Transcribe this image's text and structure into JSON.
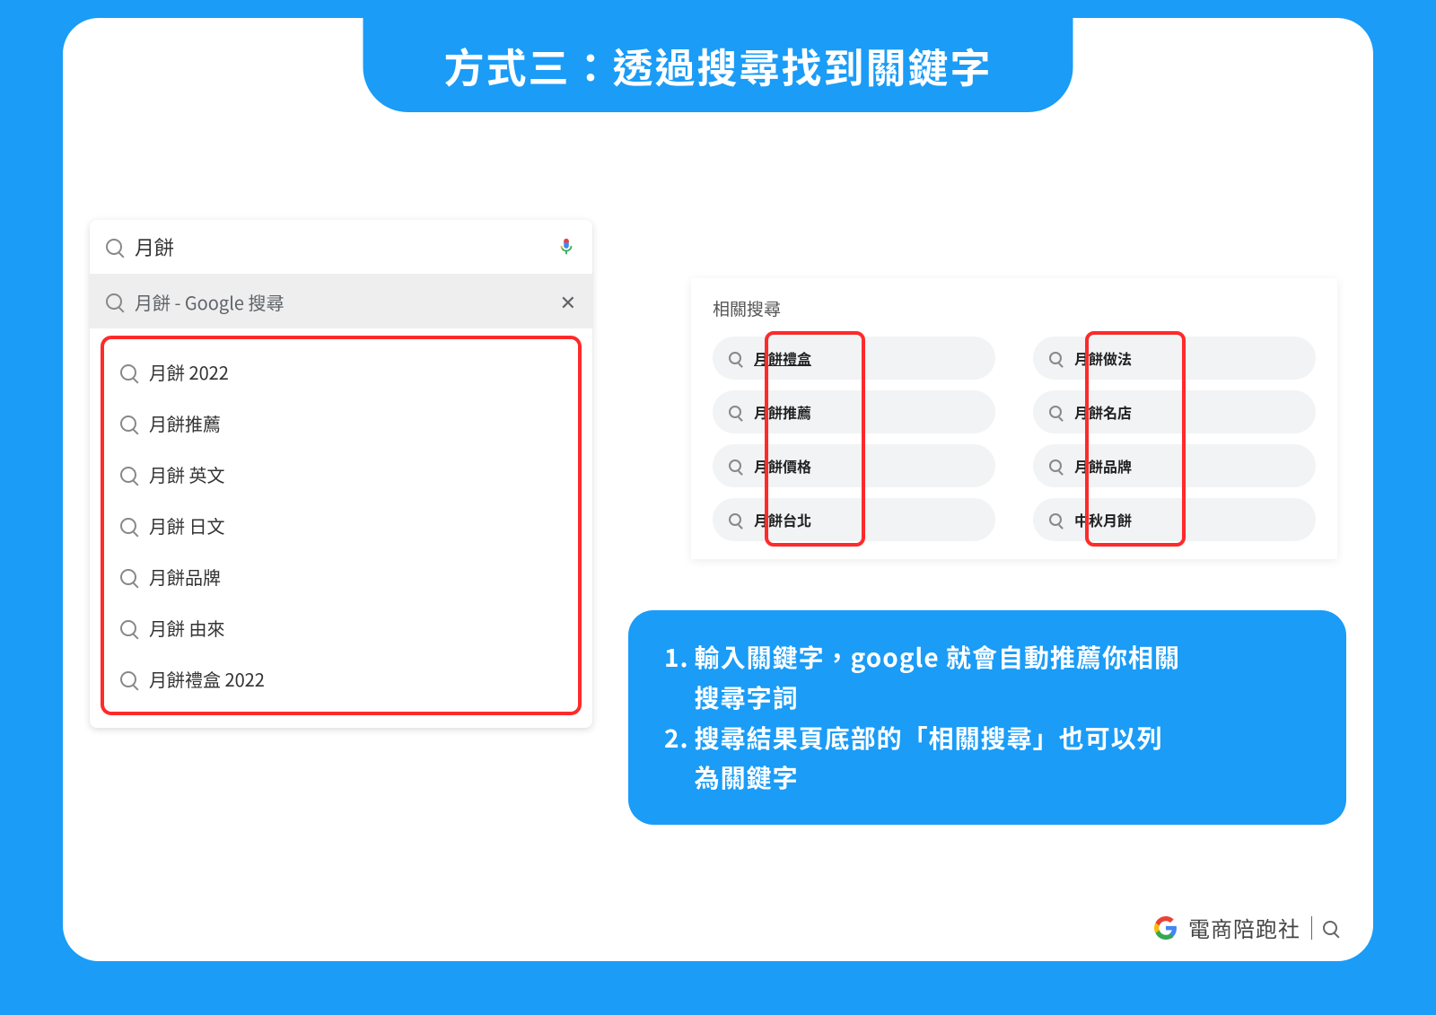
{
  "title": "方式三：透過搜尋找到關鍵字",
  "search": {
    "query": "月餅",
    "first_result": "月餅 - Google 搜尋",
    "suggestions": [
      "月餅 2022",
      "月餅推薦",
      "月餅 英文",
      "月餅 日文",
      "月餅品牌",
      "月餅 由來",
      "月餅禮盒 2022"
    ]
  },
  "related": {
    "heading": "相關搜尋",
    "col1": [
      "月餅禮盒",
      "月餅推薦",
      "月餅價格",
      "月餅台北"
    ],
    "col2": [
      "月餅做法",
      "月餅名店",
      "月餅品牌",
      "中秋月餅"
    ]
  },
  "tips": {
    "n1": "1.",
    "line1a": "輸入關鍵字，google 就會自動推薦你相關",
    "line1b": "搜尋字詞",
    "n2": "2.",
    "line2a": "搜尋結果頁底部的「相關搜尋」也可以列",
    "line2b": "為關鍵字"
  },
  "footer": {
    "brand": "電商陪跑社"
  }
}
